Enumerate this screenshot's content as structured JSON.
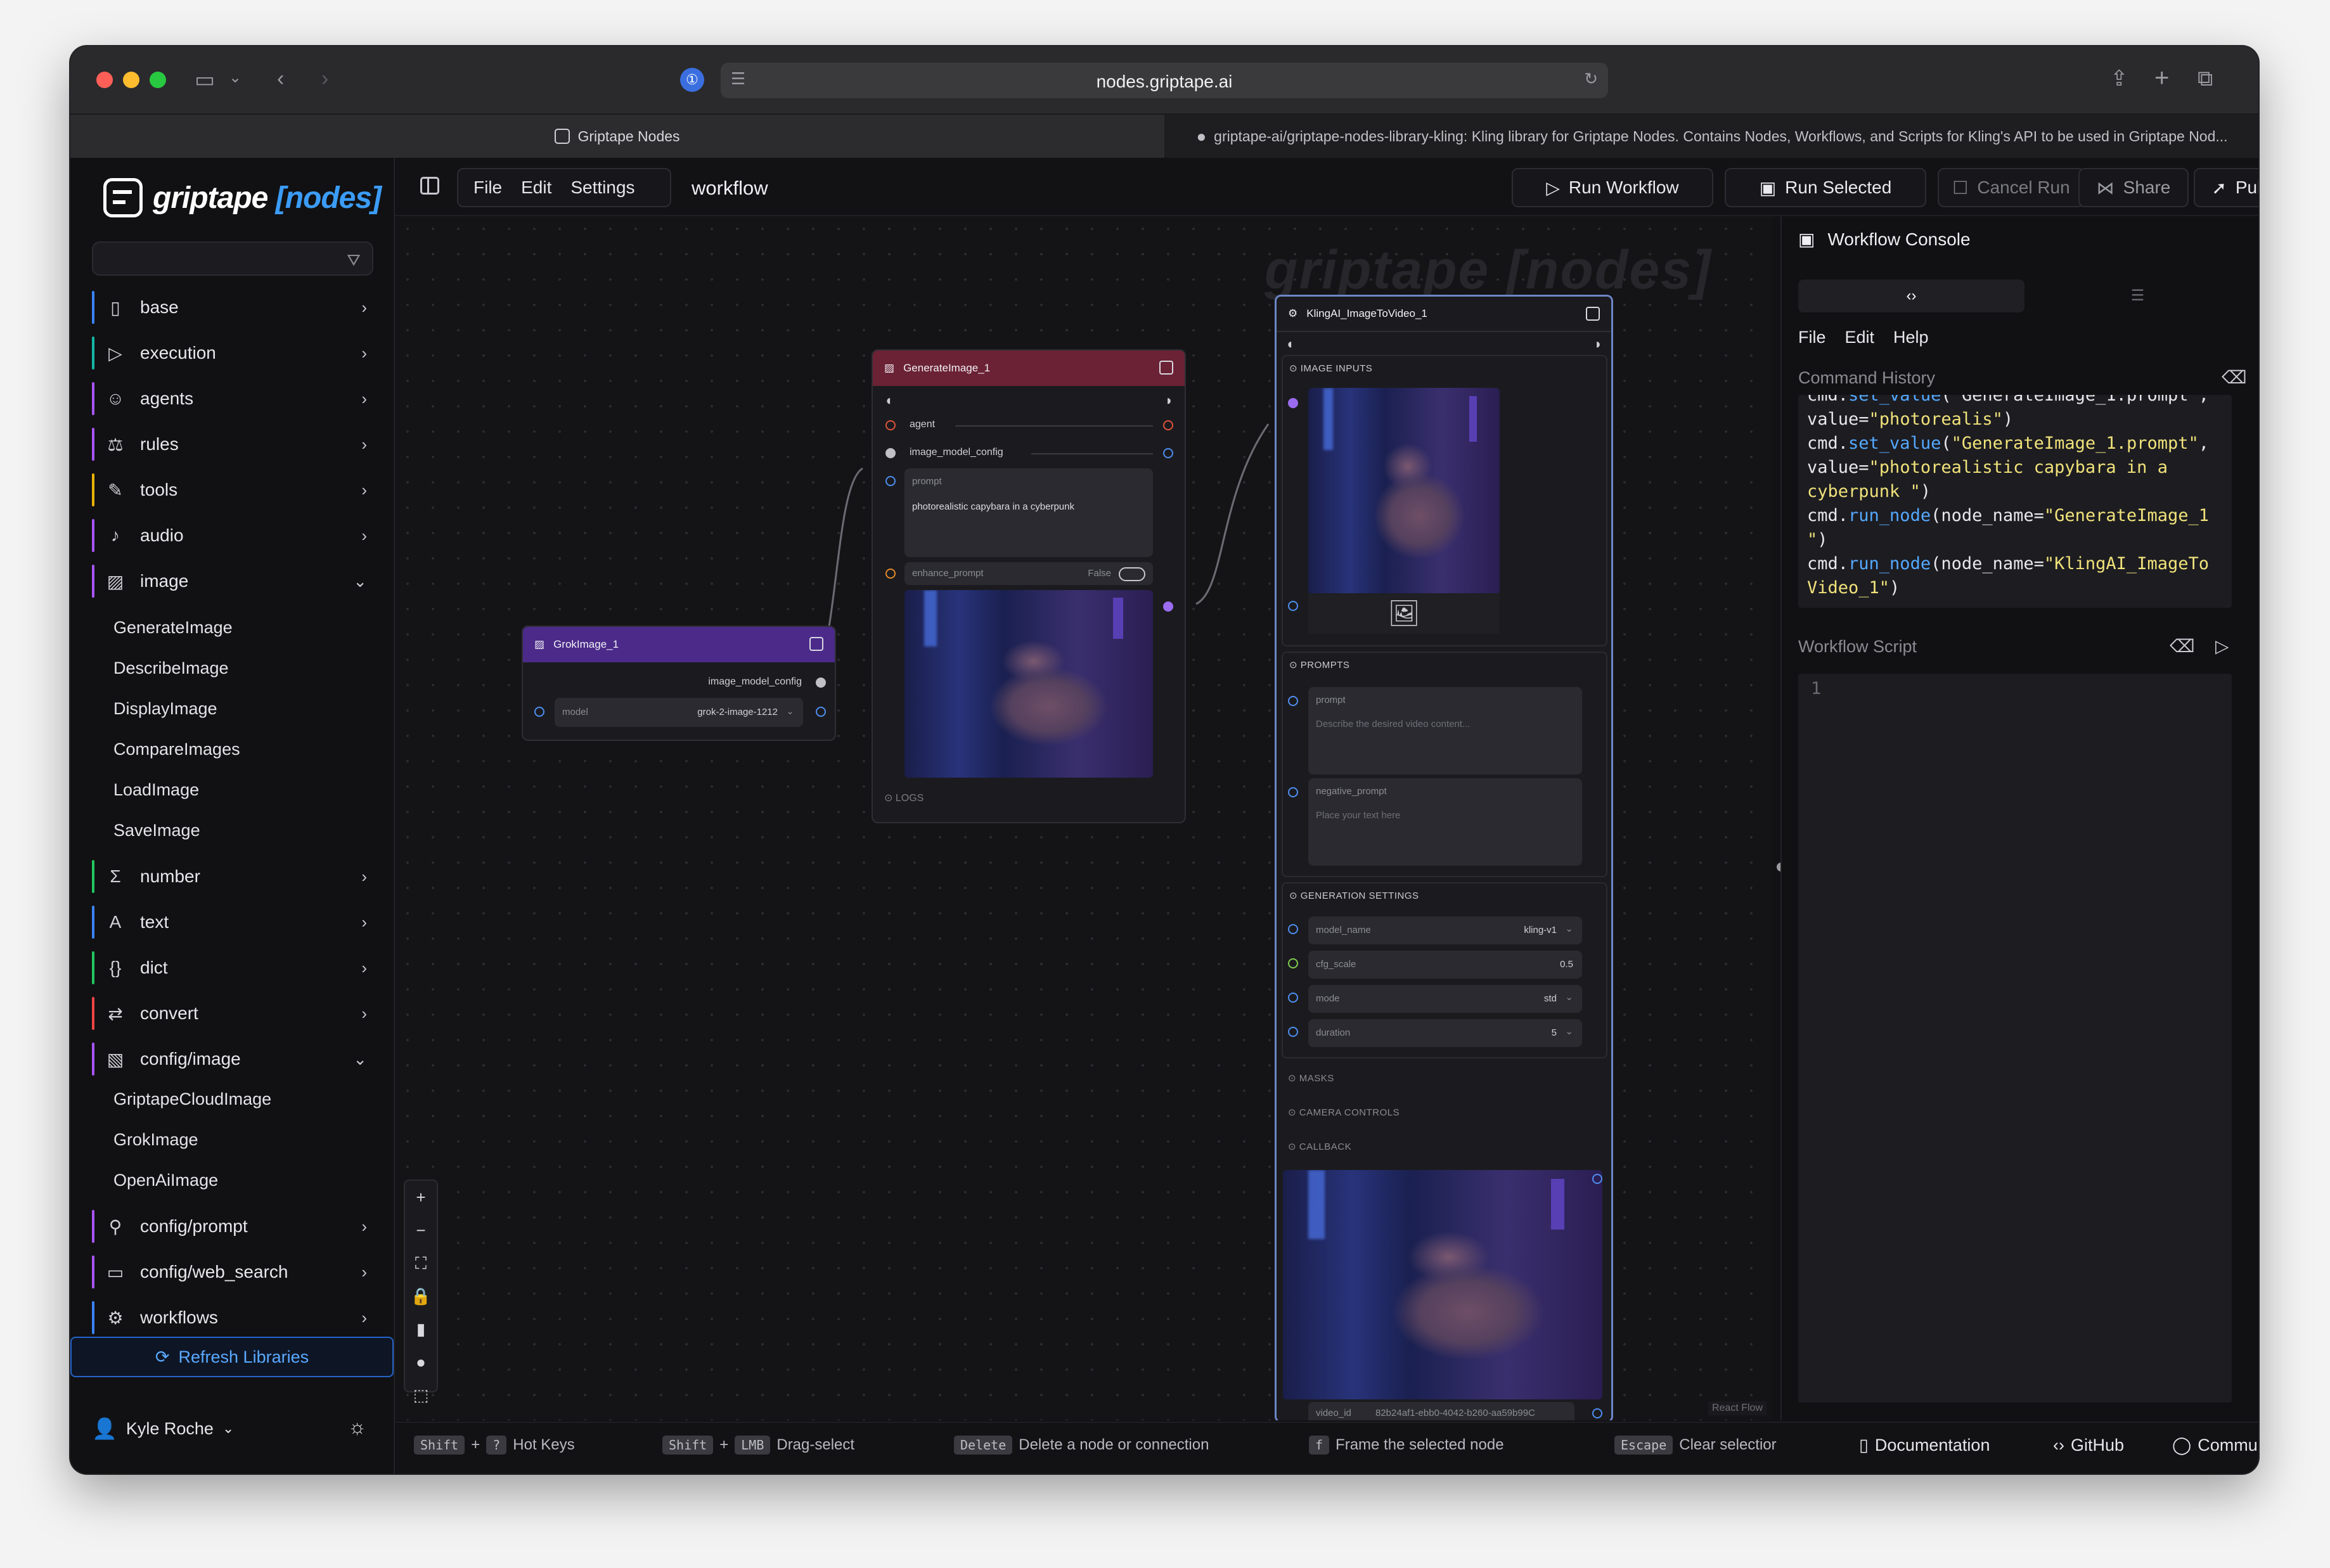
{
  "browser": {
    "url": "nodes.griptape.ai",
    "tabs": [
      {
        "label": "Griptape Nodes"
      },
      {
        "label": "griptape-ai/griptape-nodes-library-kling: Kling library for Griptape Nodes. Contains Nodes, Workflows, and Scripts for Kling's API to be used in Griptape Nod..."
      }
    ]
  },
  "sidebar": {
    "logo": {
      "word": "griptape",
      "accent": "[nodes]"
    },
    "categories": [
      {
        "label": "base",
        "icon": "book-icon",
        "color": "#3b82f6"
      },
      {
        "label": "execution",
        "icon": "play-icon",
        "color": "#14b8a6"
      },
      {
        "label": "agents",
        "icon": "robot-icon",
        "color": "#a855f7"
      },
      {
        "label": "rules",
        "icon": "scale-icon",
        "color": "#a855f7"
      },
      {
        "label": "tools",
        "icon": "wrench-icon",
        "color": "#eab308"
      },
      {
        "label": "audio",
        "icon": "mic-icon",
        "color": "#a855f7"
      },
      {
        "label": "image",
        "icon": "image-icon",
        "color": "#a855f7"
      },
      {
        "label": "number",
        "icon": "sigma-icon",
        "color": "#22c55e"
      },
      {
        "label": "text",
        "icon": "text-icon",
        "color": "#3b82f6"
      },
      {
        "label": "dict",
        "icon": "braces-icon",
        "color": "#22c55e"
      },
      {
        "label": "convert",
        "icon": "arrows-icon",
        "color": "#ef4444"
      },
      {
        "label": "config/image",
        "icon": "config-image-icon",
        "color": "#a855f7"
      },
      {
        "label": "config/prompt",
        "icon": "config-prompt-icon",
        "color": "#a855f7"
      },
      {
        "label": "config/web_search",
        "icon": "config-web-icon",
        "color": "#a855f7"
      },
      {
        "label": "workflows",
        "icon": "gear-icon",
        "color": "#3b82f6"
      }
    ],
    "image_items": [
      "GenerateImage",
      "DescribeImage",
      "DisplayImage",
      "CompareImages",
      "LoadImage",
      "SaveImage"
    ],
    "config_image_items": [
      "GriptapeCloudImage",
      "GrokImage",
      "OpenAiImage"
    ],
    "refresh_label": "Refresh Libraries",
    "user_name": "Kyle Roche"
  },
  "toolbar": {
    "menu": [
      "File",
      "Edit",
      "Settings"
    ],
    "workflow_name": "workflow",
    "run_workflow": "Run Workflow",
    "run_selected": "Run Selected",
    "cancel_run": "Cancel Run",
    "share": "Share",
    "publish": "Publish"
  },
  "canvas": {
    "watermark": "griptape [nodes]",
    "react_flow": "React Flow",
    "nodes": {
      "grok": {
        "title": "GrokImage_1",
        "output_label": "image_model_config",
        "model_label": "model",
        "model_value": "grok-2-image-1212"
      },
      "generate": {
        "title": "GenerateImage_1",
        "agent_label": "agent",
        "config_label": "image_model_config",
        "prompt_label": "prompt",
        "prompt_value": "photorealistic capybara in a cyberpunk",
        "enhance_label": "enhance_prompt",
        "enhance_value": "False",
        "logs_label": "LOGS"
      },
      "kling": {
        "title": "KlingAI_ImageToVideo_1",
        "image_inputs": "IMAGE INPUTS",
        "prompts": "PROMPTS",
        "prompt_label": "prompt",
        "prompt_placeholder": "Describe the desired video content...",
        "negative_label": "negative_prompt",
        "negative_placeholder": "Place your text here",
        "generation_settings": "GENERATION SETTINGS",
        "settings": [
          {
            "label": "model_name",
            "value": "kling-v1"
          },
          {
            "label": "cfg_scale",
            "value": "0.5"
          },
          {
            "label": "mode",
            "value": "std"
          },
          {
            "label": "duration",
            "value": "5"
          }
        ],
        "masks": "MASKS",
        "camera_controls": "CAMERA CONTROLS",
        "callback": "CALLBACK",
        "video_id_label": "video_id",
        "video_id_value": "82b24af1-ebb0-4042-b260-aa59b99C"
      }
    }
  },
  "hotkeys": [
    {
      "keys": [
        "Shift",
        "?"
      ],
      "label": "Hot Keys"
    },
    {
      "keys": [
        "Shift",
        "LMB"
      ],
      "label": "Drag-select"
    },
    {
      "keys": [
        "Delete"
      ],
      "label": "Delete a node or connection"
    },
    {
      "keys": [
        "f"
      ],
      "label": "Frame the selected node"
    },
    {
      "keys": [
        "Escape"
      ],
      "label": "Clear selectior"
    }
  ],
  "footer_links": {
    "docs": "Documentation",
    "github": "GitHub",
    "community": "Community"
  },
  "console": {
    "title": "Workflow Console",
    "menu": [
      "File",
      "Edit",
      "Help"
    ],
    "history_title": "Command History",
    "history_lines": [
      {
        "pre": "cmd.",
        "fn": "set_value",
        "rest": "(\"GenerateImage_1.prompt\","
      },
      {
        "pre": "value=",
        "str": "\"photorealis\"",
        "rest": ")"
      },
      {
        "pre": "cmd.",
        "fn": "set_value",
        "rest": "(",
        "str": "\"GenerateImage_1.prompt\"",
        "rest2": ","
      },
      {
        "pre": "value=",
        "str": "\"photorealistic capybara in a",
        "rest": ""
      },
      {
        "pre": "",
        "str": "cyberpunk \"",
        "rest": ")"
      },
      {
        "pre": "cmd.",
        "fn": "run_node",
        "rest": "(node_name=",
        "str": "\"GenerateImage_1",
        "rest2": ""
      },
      {
        "pre": "",
        "str": "\"",
        "rest": ")"
      },
      {
        "pre": "cmd.",
        "fn": "run_node",
        "rest": "(node_name=",
        "str": "\"KlingAI_ImageTo",
        "rest2": ""
      },
      {
        "pre": "",
        "str": "Video_1\"",
        "rest": ")"
      }
    ],
    "script_title": "Workflow Script",
    "script_line": "1"
  }
}
